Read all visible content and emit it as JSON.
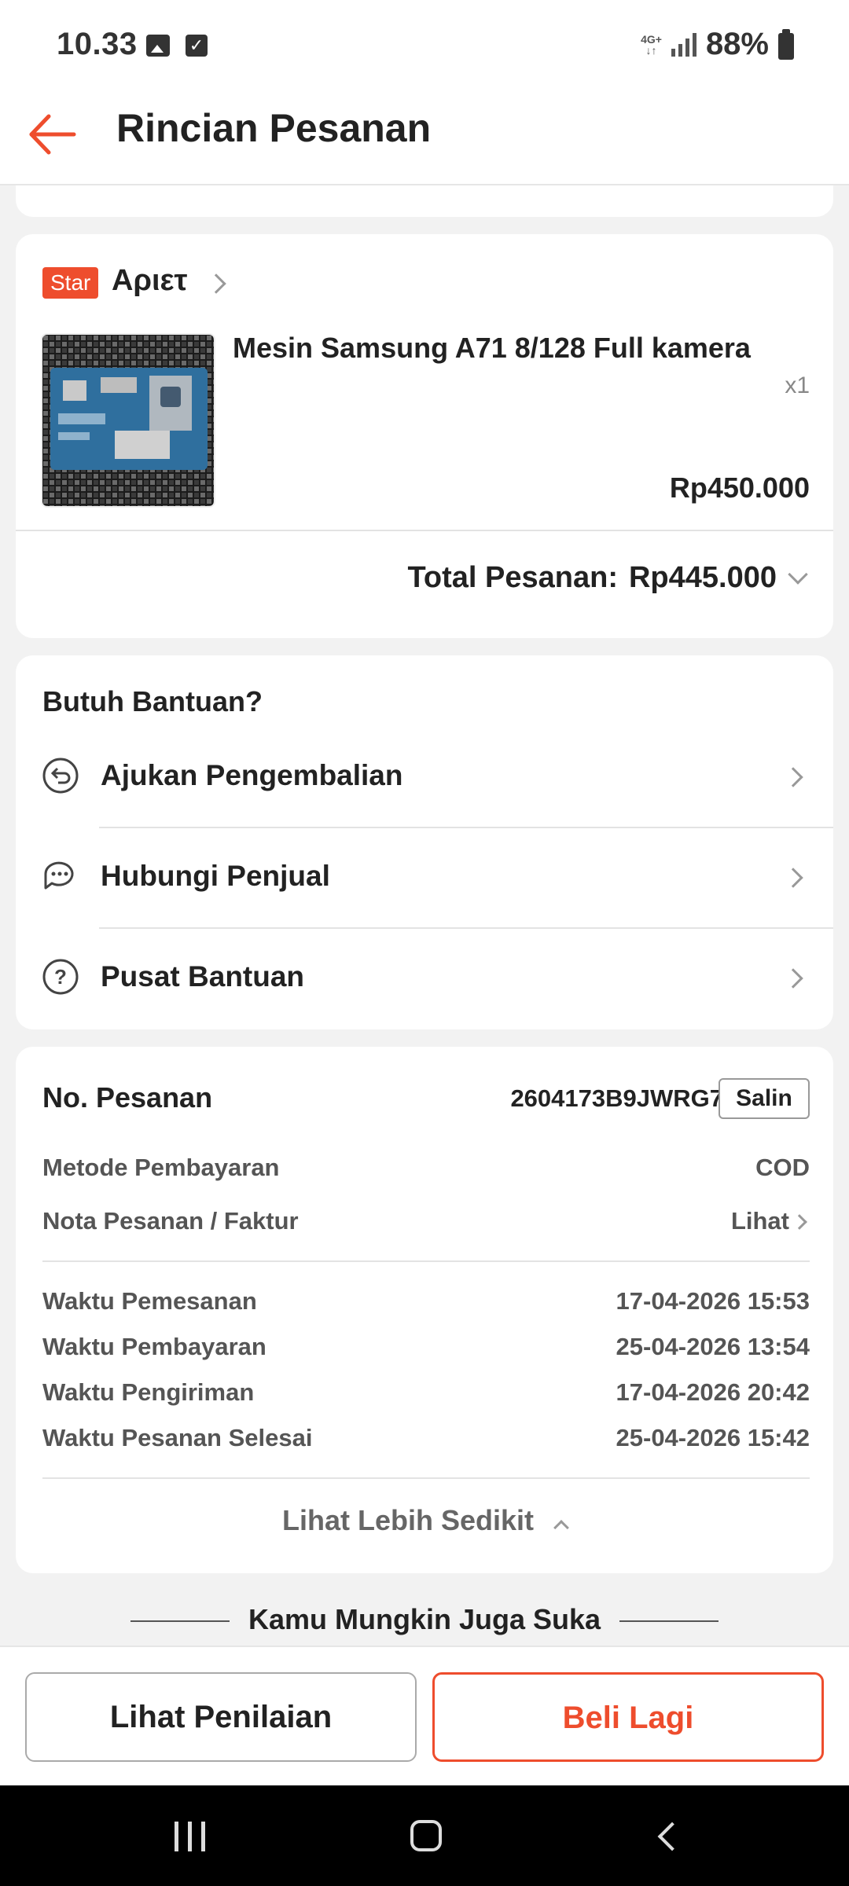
{
  "status_bar": {
    "time": "10.33",
    "network_top": "4G+",
    "network_bottom": "↓↑",
    "battery": "88%"
  },
  "header": {
    "title": "Rincian Pesanan",
    "accent_color": "#ee4d2d"
  },
  "order_item": {
    "badge": "Star",
    "shop_name": "Αριετ",
    "product_name": "Mesin Samsung A71 8/128 Full kamera",
    "quantity": "x1",
    "price": "Rp450.000",
    "total_label": "Total Pesanan:",
    "total_value": "Rp445.000"
  },
  "help": {
    "title": "Butuh Bantuan?",
    "items": [
      {
        "label": "Ajukan Pengembalian",
        "icon": "return-icon"
      },
      {
        "label": "Hubungi Penjual",
        "icon": "chat-icon"
      },
      {
        "label": "Pusat Bantuan",
        "icon": "help-circle-icon"
      }
    ]
  },
  "order_info": {
    "order_no_label": "No. Pesanan",
    "order_no_value": "2604173B9JWRG7",
    "copy_label": "Salin",
    "payment_method_label": "Metode Pembayaran",
    "payment_method_value": "COD",
    "invoice_label": "Nota Pesanan / Faktur",
    "invoice_value": "Lihat",
    "times": [
      {
        "label": "Waktu Pemesanan",
        "value": "17-04-2026 15:53"
      },
      {
        "label": "Waktu Pembayaran",
        "value": "25-04-2026 13:54"
      },
      {
        "label": "Waktu Pengiriman",
        "value": "17-04-2026 20:42"
      },
      {
        "label": "Waktu Pesanan Selesai",
        "value": "25-04-2026 15:42"
      }
    ],
    "see_less": "Lihat Lebih Sedikit"
  },
  "suggestions": {
    "title": "Kamu Mungkin Juga Suka"
  },
  "actions": {
    "review": "Lihat Penilaian",
    "buy_again": "Beli Lagi"
  }
}
